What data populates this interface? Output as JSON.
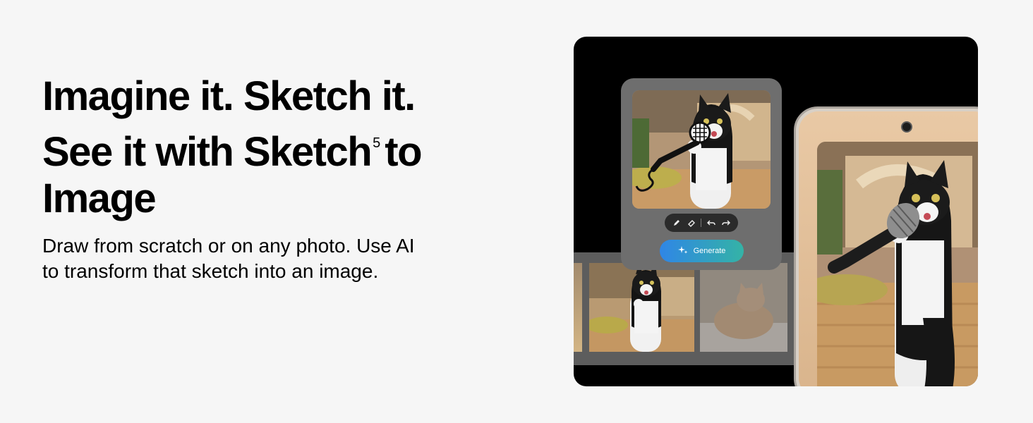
{
  "headline": {
    "line1": "Imagine it. Sketch it.",
    "line2a": "See it with Sketch",
    "footnote": "5",
    "line2b": "to",
    "line3": "Image"
  },
  "description": {
    "line1": "Draw from scratch or on any photo. Use AI",
    "line2": "to transform that sketch into an image."
  },
  "panel": {
    "generate_label": "Generate",
    "tools": [
      "pen-icon",
      "eraser-icon",
      "undo-icon",
      "redo-icon"
    ]
  },
  "colors": {
    "background": "#f6f6f6",
    "stage": "#000000",
    "generate_start": "#2f86e6",
    "generate_end": "#34b3a6"
  }
}
